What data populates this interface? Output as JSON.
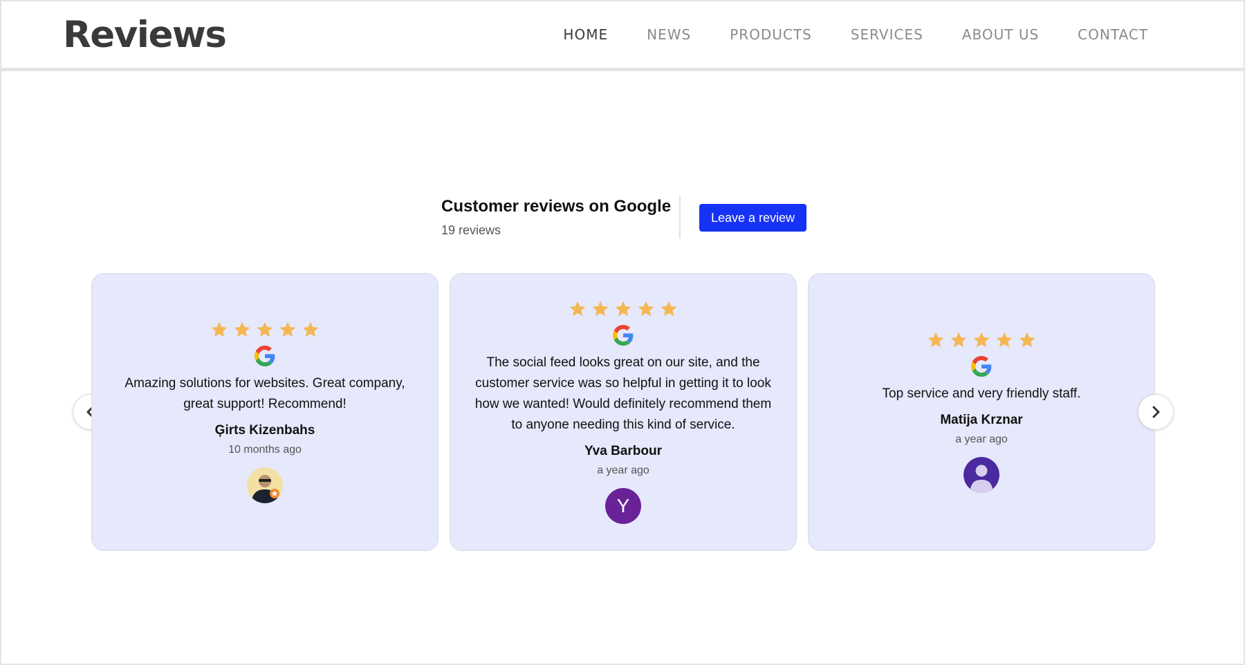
{
  "header": {
    "logo": "Reviews",
    "nav": [
      "HOME",
      "NEWS",
      "PRODUCTS",
      "SERVICES",
      "ABOUT US",
      "CONTACT"
    ],
    "active_nav": "HOME"
  },
  "summary": {
    "title": "Customer reviews on Google",
    "count": "19 reviews",
    "button_label": "Leave a review"
  },
  "colors": {
    "accent": "#1532f5",
    "card_bg": "#e6e8fb",
    "star": "#f5b754",
    "avatar_purple": "#6a2298",
    "avatar_indigo": "#4a2a9e"
  },
  "reviews": [
    {
      "rating": 5,
      "source_icon": "google-icon",
      "text": "Amazing solutions for websites. Great company, great support! Recommend!",
      "name": "Ģirts Kizenbahs",
      "date": "10 months ago",
      "avatar": "photo"
    },
    {
      "rating": 5,
      "source_icon": "google-icon",
      "text": "The social feed looks great on our site, and the customer service was so helpful in getting it to look how we wanted! Would definitely recommend them to anyone needing this kind of service.",
      "name": "Yva Barbour",
      "date": "a year ago",
      "avatar": "Y"
    },
    {
      "rating": 5,
      "source_icon": "google-icon",
      "text": "Top service and very friendly staff.",
      "name": "Matija Krznar",
      "date": "a year ago",
      "avatar": "default-user"
    }
  ],
  "carousel": {
    "prev_icon": "chevron-left-icon",
    "next_icon": "chevron-right-icon"
  }
}
